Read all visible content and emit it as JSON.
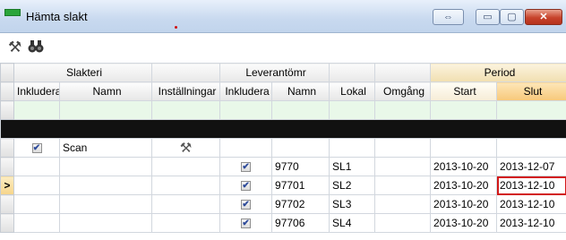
{
  "window": {
    "title": "Hämta slakt",
    "buttons": {
      "restore2": "⇔",
      "minimize": "▭",
      "maximize": "▢",
      "close": "✕"
    }
  },
  "toolbar": {
    "icons": [
      "tools-icon",
      "binoculars-icon"
    ]
  },
  "grid": {
    "groups": {
      "slakteri": "Slakteri",
      "leverantor": "Leverantömr",
      "period": "Period"
    },
    "headers": {
      "inkludera": "Inkludera",
      "namn": "Namn",
      "installningar": "Inställningar",
      "lev_inkludera": "Inkludera",
      "lev_namn": "Namn",
      "lokal": "Lokal",
      "omgang": "Omgång",
      "start": "Start",
      "slut": "Slut"
    },
    "parent_row": {
      "inkludera": true,
      "namn": "Scan"
    },
    "rows": [
      {
        "inkludera": true,
        "namn": "9770",
        "lokal": "SL1",
        "start": "2013-10-20",
        "slut": "2013-12-07",
        "current": false
      },
      {
        "inkludera": true,
        "namn": "97701",
        "lokal": "SL2",
        "start": "2013-10-20",
        "slut": "2013-12-10",
        "current": true
      },
      {
        "inkludera": true,
        "namn": "97702",
        "lokal": "SL3",
        "start": "2013-10-20",
        "slut": "2013-12-10",
        "current": false
      },
      {
        "inkludera": true,
        "namn": "97706",
        "lokal": "SL4",
        "start": "2013-10-20",
        "slut": "2013-12-10",
        "current": false
      }
    ],
    "current_row_marker": ">",
    "check_glyph": "✔"
  }
}
